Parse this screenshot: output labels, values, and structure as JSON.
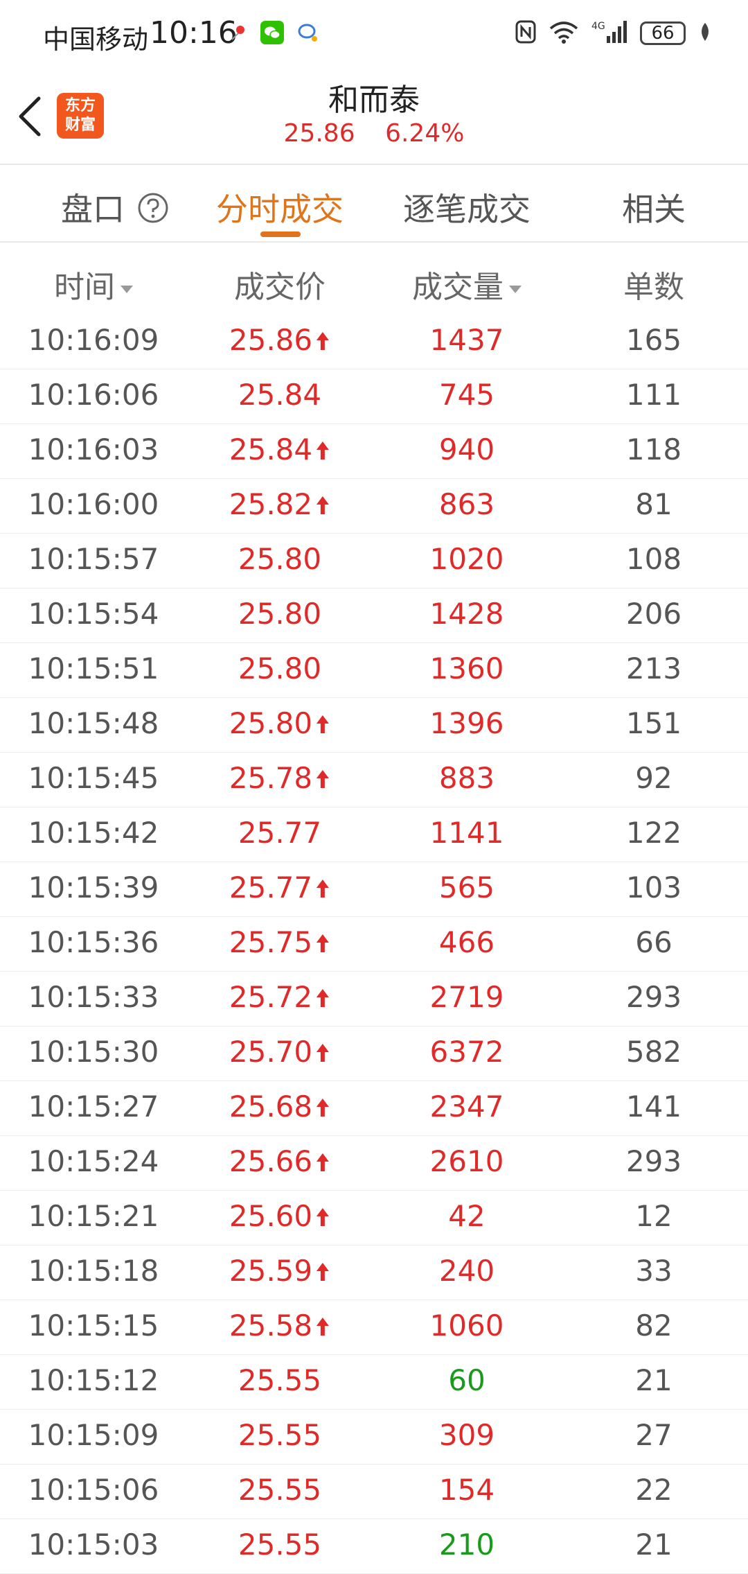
{
  "status_bar": {
    "carrier": "中国移动",
    "time": "10:16",
    "battery": "66",
    "network": "4G"
  },
  "header": {
    "logo_text_line1": "东方",
    "logo_text_line2": "财富",
    "stock_name": "和而泰",
    "price": "25.86",
    "change_pct": "6.24%"
  },
  "tabs": [
    {
      "label": "盘口",
      "active": false
    },
    {
      "label": "分时成交",
      "active": true
    },
    {
      "label": "逐笔成交",
      "active": false
    },
    {
      "label": "相关",
      "active": false
    }
  ],
  "columns": [
    "时间",
    "成交价",
    "成交量",
    "单数"
  ],
  "colors": {
    "up_red": "#e02a2a",
    "down_green": "#1a9a1a",
    "accent_orange": "#e0741b"
  },
  "trades": [
    {
      "time": "10:16:09",
      "price": "25.86",
      "up": true,
      "volume": "1437",
      "vol_color": "red",
      "count": "165"
    },
    {
      "time": "10:16:06",
      "price": "25.84",
      "up": false,
      "volume": "745",
      "vol_color": "red",
      "count": "111"
    },
    {
      "time": "10:16:03",
      "price": "25.84",
      "up": true,
      "volume": "940",
      "vol_color": "red",
      "count": "118"
    },
    {
      "time": "10:16:00",
      "price": "25.82",
      "up": true,
      "volume": "863",
      "vol_color": "red",
      "count": "81"
    },
    {
      "time": "10:15:57",
      "price": "25.80",
      "up": false,
      "volume": "1020",
      "vol_color": "red",
      "count": "108"
    },
    {
      "time": "10:15:54",
      "price": "25.80",
      "up": false,
      "volume": "1428",
      "vol_color": "red",
      "count": "206"
    },
    {
      "time": "10:15:51",
      "price": "25.80",
      "up": false,
      "volume": "1360",
      "vol_color": "red",
      "count": "213"
    },
    {
      "time": "10:15:48",
      "price": "25.80",
      "up": true,
      "volume": "1396",
      "vol_color": "red",
      "count": "151"
    },
    {
      "time": "10:15:45",
      "price": "25.78",
      "up": true,
      "volume": "883",
      "vol_color": "red",
      "count": "92"
    },
    {
      "time": "10:15:42",
      "price": "25.77",
      "up": false,
      "volume": "1141",
      "vol_color": "red",
      "count": "122"
    },
    {
      "time": "10:15:39",
      "price": "25.77",
      "up": true,
      "volume": "565",
      "vol_color": "red",
      "count": "103"
    },
    {
      "time": "10:15:36",
      "price": "25.75",
      "up": true,
      "volume": "466",
      "vol_color": "red",
      "count": "66"
    },
    {
      "time": "10:15:33",
      "price": "25.72",
      "up": true,
      "volume": "2719",
      "vol_color": "red",
      "count": "293"
    },
    {
      "time": "10:15:30",
      "price": "25.70",
      "up": true,
      "volume": "6372",
      "vol_color": "red",
      "count": "582"
    },
    {
      "time": "10:15:27",
      "price": "25.68",
      "up": true,
      "volume": "2347",
      "vol_color": "red",
      "count": "141"
    },
    {
      "time": "10:15:24",
      "price": "25.66",
      "up": true,
      "volume": "2610",
      "vol_color": "red",
      "count": "293"
    },
    {
      "time": "10:15:21",
      "price": "25.60",
      "up": true,
      "volume": "42",
      "vol_color": "red",
      "count": "12"
    },
    {
      "time": "10:15:18",
      "price": "25.59",
      "up": true,
      "volume": "240",
      "vol_color": "red",
      "count": "33"
    },
    {
      "time": "10:15:15",
      "price": "25.58",
      "up": true,
      "volume": "1060",
      "vol_color": "red",
      "count": "82"
    },
    {
      "time": "10:15:12",
      "price": "25.55",
      "up": false,
      "volume": "60",
      "vol_color": "green",
      "count": "21"
    },
    {
      "time": "10:15:09",
      "price": "25.55",
      "up": false,
      "volume": "309",
      "vol_color": "red",
      "count": "27"
    },
    {
      "time": "10:15:06",
      "price": "25.55",
      "up": false,
      "volume": "154",
      "vol_color": "red",
      "count": "22"
    },
    {
      "time": "10:15:03",
      "price": "25.55",
      "up": false,
      "volume": "210",
      "vol_color": "green",
      "count": "21"
    }
  ]
}
